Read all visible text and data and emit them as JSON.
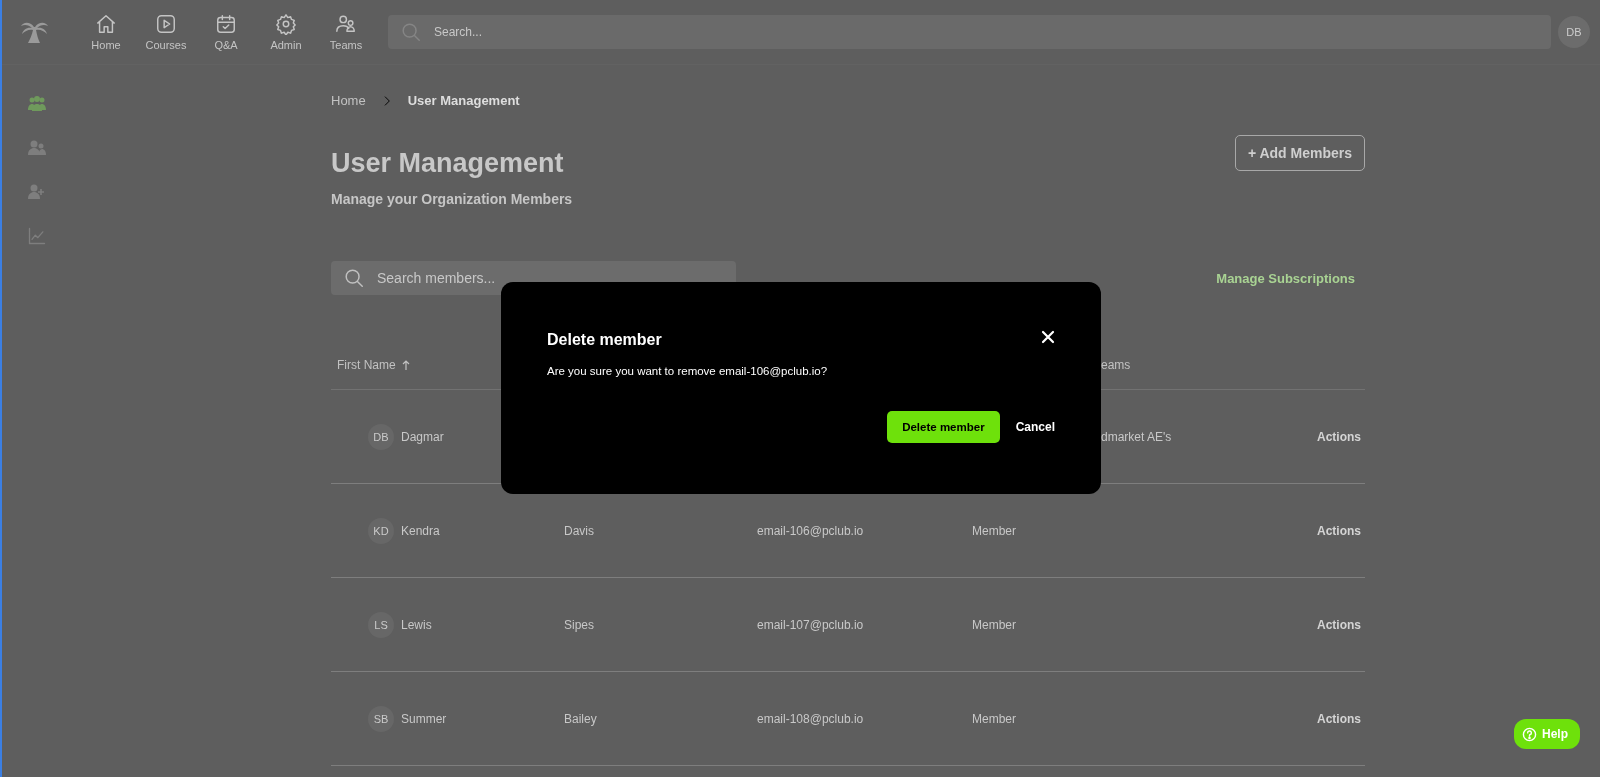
{
  "top_nav": {
    "items": [
      {
        "label": "Home"
      },
      {
        "label": "Courses"
      },
      {
        "label": "Q&A"
      },
      {
        "label": "Admin"
      },
      {
        "label": "Teams"
      }
    ],
    "search": {
      "placeholder": "Search..."
    },
    "avatar": "DB"
  },
  "sidebar": {
    "items": [
      {
        "selected": true
      },
      {
        "selected": false
      },
      {
        "selected": false
      },
      {
        "selected": false
      }
    ]
  },
  "breadcrumb": [
    "Home",
    "User Management"
  ],
  "title": "User Management",
  "subtitle": "Manage your Organization Members",
  "add_button": "+ Add Members",
  "member_search": {
    "placeholder": "Search members..."
  },
  "manage_link": "Manage Subscriptions",
  "table": {
    "columns": [
      {
        "label": "First Name",
        "sorted": true
      },
      {
        "label": "eams",
        "sorted": false
      }
    ],
    "rows": [
      {
        "initials": "DB",
        "first_name": "Dagmar",
        "teams": "dmarket AE's",
        "action": "Actions"
      },
      {
        "initials": "KD",
        "first_name": "Kendra",
        "last_name": "Davis",
        "email": "email-106@pclub.io",
        "role": "Member",
        "action": "Actions"
      },
      {
        "initials": "LS",
        "first_name": "Lewis",
        "last_name": "Sipes",
        "email": "email-107@pclub.io",
        "role": "Member",
        "action": "Actions"
      },
      {
        "initials": "SB",
        "first_name": "Summer",
        "last_name": "Bailey",
        "email": "email-108@pclub.io",
        "role": "Member",
        "action": "Actions"
      }
    ]
  },
  "modal": {
    "title": "Delete member",
    "message": "Are you sure you want to remove email-106@pclub.io?",
    "confirm": "Delete member",
    "cancel": "Cancel"
  },
  "help": "Help"
}
